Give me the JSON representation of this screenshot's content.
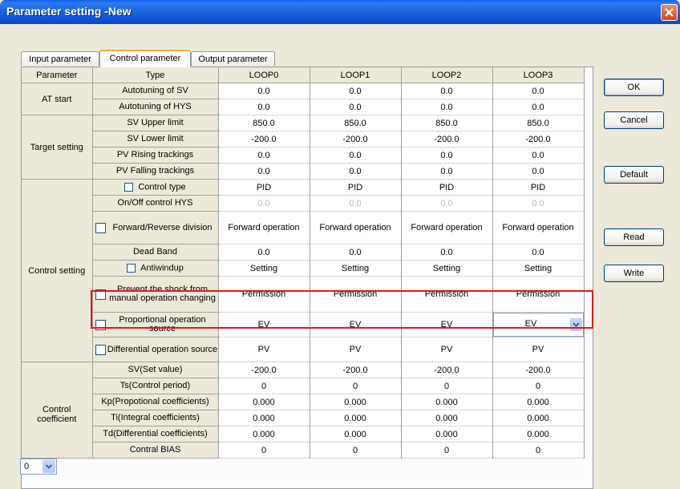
{
  "window": {
    "title": "Parameter setting -New"
  },
  "tabs": [
    {
      "label": "Input parameter"
    },
    {
      "label": "Control parameter"
    },
    {
      "label": "Output parameter"
    }
  ],
  "headers": {
    "parameter": "Parameter",
    "type": "Type",
    "loops": [
      "LOOP0",
      "LOOP1",
      "LOOP2",
      "LOOP3"
    ]
  },
  "groups": {
    "at_start": "AT start",
    "target_setting": "Target setting",
    "control_setting": "Control setting",
    "control_coefficient": "Control coefficient"
  },
  "rows": [
    {
      "type": "Autotuning of SV",
      "values": [
        "0.0",
        "0.0",
        "0.0",
        "0.0"
      ]
    },
    {
      "type": "Autotuning of HYS",
      "values": [
        "0.0",
        "0.0",
        "0.0",
        "0.0"
      ]
    },
    {
      "type": "SV Upper limit",
      "values": [
        "850.0",
        "850.0",
        "850.0",
        "850.0"
      ]
    },
    {
      "type": "SV Lower limit",
      "values": [
        "-200.0",
        "-200.0",
        "-200.0",
        "-200.0"
      ]
    },
    {
      "type": "PV Rising trackings",
      "values": [
        "0.0",
        "0.0",
        "0.0",
        "0.0"
      ]
    },
    {
      "type": "PV Falling trackings",
      "values": [
        "0.0",
        "0.0",
        "0.0",
        "0.0"
      ]
    },
    {
      "type": "Control type",
      "values": [
        "PID",
        "PID",
        "PID",
        "PID"
      ]
    },
    {
      "type": "On/Off control HYS",
      "values": [
        "0.0",
        "0.0",
        "0.0",
        "0.0"
      ]
    },
    {
      "type": "Forward/Reverse division",
      "values": [
        "Forward operation",
        "Forward operation",
        "Forward operation",
        "Forward operation"
      ]
    },
    {
      "type": "Dead Band",
      "values": [
        "0.0",
        "0.0",
        "0.0",
        "0.0"
      ]
    },
    {
      "type": "Antiwindup",
      "values": [
        "Setting",
        "Setting",
        "Setting",
        "Setting"
      ]
    },
    {
      "type": "Prevent the shock from manual operation changing",
      "values": [
        "Permission",
        "Permission",
        "Permission",
        "Permission"
      ]
    },
    {
      "type": "Proportional operation source",
      "values": [
        "EV",
        "EV",
        "EV",
        "EV"
      ]
    },
    {
      "type": "Differential operation source",
      "values": [
        "PV",
        "PV",
        "PV",
        "PV"
      ]
    },
    {
      "type": "SV(Set value)",
      "values": [
        "-200.0",
        "-200.0",
        "-200.0",
        "-200.0"
      ]
    },
    {
      "type": "Ts(Control period)",
      "values": [
        "0",
        "0",
        "0",
        "0"
      ]
    },
    {
      "type": "Kp(Propotional coefficients)",
      "values": [
        "0.000",
        "0.000",
        "0.000",
        "0.000"
      ]
    },
    {
      "type": "Ti(Integral coefficients)",
      "values": [
        "0.000",
        "0.000",
        "0.000",
        "0.000"
      ]
    },
    {
      "type": "Td(Differential coefficients)",
      "values": [
        "0.000",
        "0.000",
        "0.000",
        "0.000"
      ]
    },
    {
      "type": "Contral BIAS",
      "values": [
        "0",
        "0",
        "0",
        "0"
      ]
    }
  ],
  "coef_select": {
    "value": "0"
  },
  "buttons": {
    "ok": "OK",
    "cancel": "Cancel",
    "default": "Default",
    "read": "Read",
    "write": "Write"
  },
  "icons": {
    "close": "close-icon",
    "dropdown": "chevron-down-icon",
    "checkbox": "checkbox-icon"
  }
}
